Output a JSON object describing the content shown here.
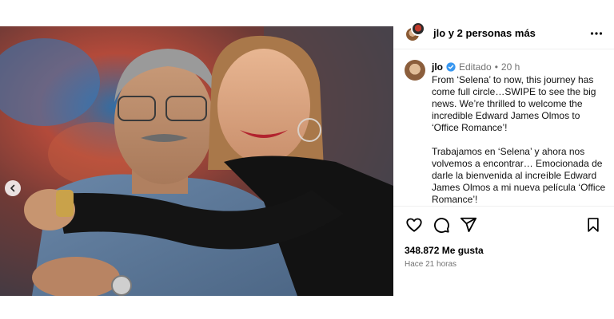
{
  "header": {
    "title_user": "jlo",
    "title_rest": " y 2 personas más",
    "more_icon": "more-horizontal-icon"
  },
  "post": {
    "username": "jlo",
    "edited": "Editado",
    "separator": "•",
    "time": "20 h",
    "caption": "From ‘Selena’ to now, this journey has come full circle…SWIPE to see the big news. We’re thrilled to welcome the incredible Edward James Olmos to ‘Office Romance’!\n\nTrabajamos en ‘Selena’ y ahora nos volvemos a encontrar… Emocionada de darle la bienvenida al increíble Edward James Olmos a mi nueva película ‘Office Romance’!"
  },
  "actions": {
    "icons": [
      "heart-icon",
      "comment-icon",
      "share-icon",
      "bookmark-icon"
    ]
  },
  "likes": "348.872 Me gusta",
  "posted_ago": "Hace 21 horas",
  "carousel": {
    "slide_count": 2,
    "active_index": 1
  },
  "colors": {
    "verified": "#3897f0",
    "muted": "#737373",
    "divider": "#efefef"
  }
}
